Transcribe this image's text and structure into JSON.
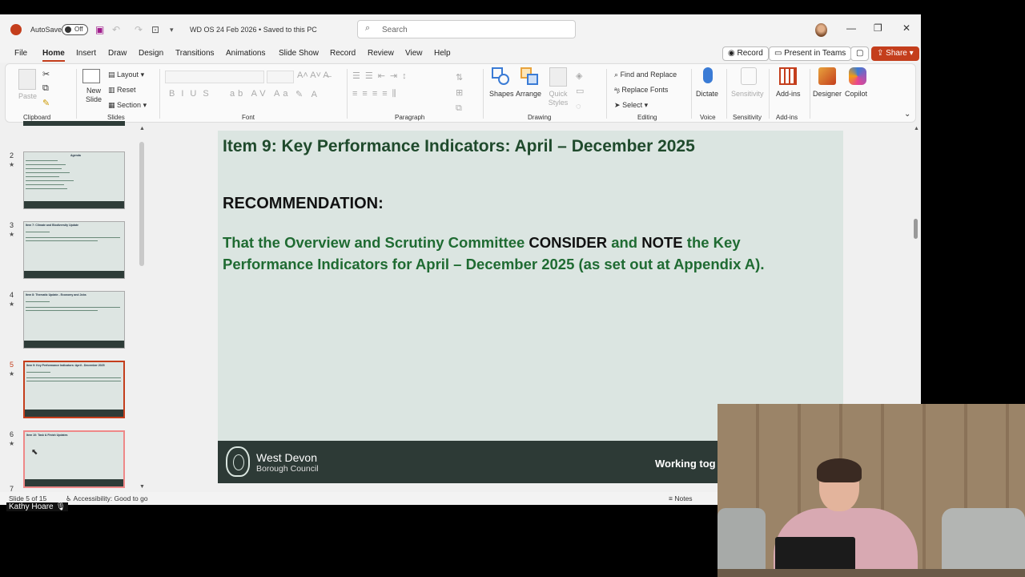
{
  "titlebar": {
    "autosave_label": "AutoSave",
    "autosave_state": "Off",
    "doc_name": "WD OS 24 Feb 2026 • Saved to this PC",
    "search_placeholder": "Search"
  },
  "menu": {
    "tabs": [
      "File",
      "Home",
      "Insert",
      "Draw",
      "Design",
      "Transitions",
      "Animations",
      "Slide Show",
      "Record",
      "Review",
      "View",
      "Help"
    ],
    "active": "Home",
    "record_label": "Record",
    "present_label": "Present in Teams",
    "share_label": "Share"
  },
  "ribbon": {
    "clipboard": {
      "paste": "Paste",
      "label": "Clipboard"
    },
    "slides": {
      "new_slide": "New Slide",
      "layout": "Layout",
      "reset": "Reset",
      "section": "Section",
      "label": "Slides"
    },
    "font": {
      "label": "Font"
    },
    "paragraph": {
      "label": "Paragraph"
    },
    "drawing": {
      "shapes": "Shapes",
      "arrange": "Arrange",
      "quick_styles": "Quick Styles",
      "label": "Drawing"
    },
    "editing": {
      "find_replace": "Find and Replace",
      "replace_fonts": "Replace Fonts",
      "select": "Select",
      "label": "Editing"
    },
    "voice": {
      "dictate": "Dictate",
      "label": "Voice"
    },
    "sensitivity": {
      "btn": "Sensitivity",
      "label": "Sensitivity"
    },
    "addins": {
      "btn": "Add-ins",
      "label": "Add-ins"
    },
    "designer": "Designer",
    "copilot": "Copilot"
  },
  "thumbnails": [
    {
      "num": "2",
      "title": "Agenda"
    },
    {
      "num": "3",
      "title": "Item 7: Climate and Biodiversity Update"
    },
    {
      "num": "4",
      "title": "Item 8: Thematic Update - Economy and Jobs"
    },
    {
      "num": "5",
      "title": "Item 9: Key Performance Indicators: April - December 2025"
    },
    {
      "num": "6",
      "title": "Item 10: Task & Finish Updates"
    },
    {
      "num": "7",
      "title": ""
    }
  ],
  "slide": {
    "title": "Item 9: Key Performance Indicators: April – December 2025",
    "recommendation": "RECOMMENDATION:",
    "body_1": "That the Overview and Scrutiny Committee ",
    "kw_1": "CONSIDER",
    "body_2": " and ",
    "kw_2": "NOTE",
    "body_3": " the Key Performance Indicators for April – December 2025 (as set out at Appendix A).",
    "org_line1": "West Devon",
    "org_line2": "Borough Council",
    "tagline": "Working tog"
  },
  "status": {
    "slide_counter": "Slide 5 of 15",
    "accessibility": "Accessibility: Good to go",
    "notes": "Notes"
  },
  "caption": {
    "name": "Kathy Hoare"
  },
  "colors": {
    "accent": "#c43e1c",
    "slide_bg": "#dbe5e1",
    "title_green": "#1f4a2c",
    "body_green": "#1f6b32",
    "footer": "#2d3a36"
  }
}
